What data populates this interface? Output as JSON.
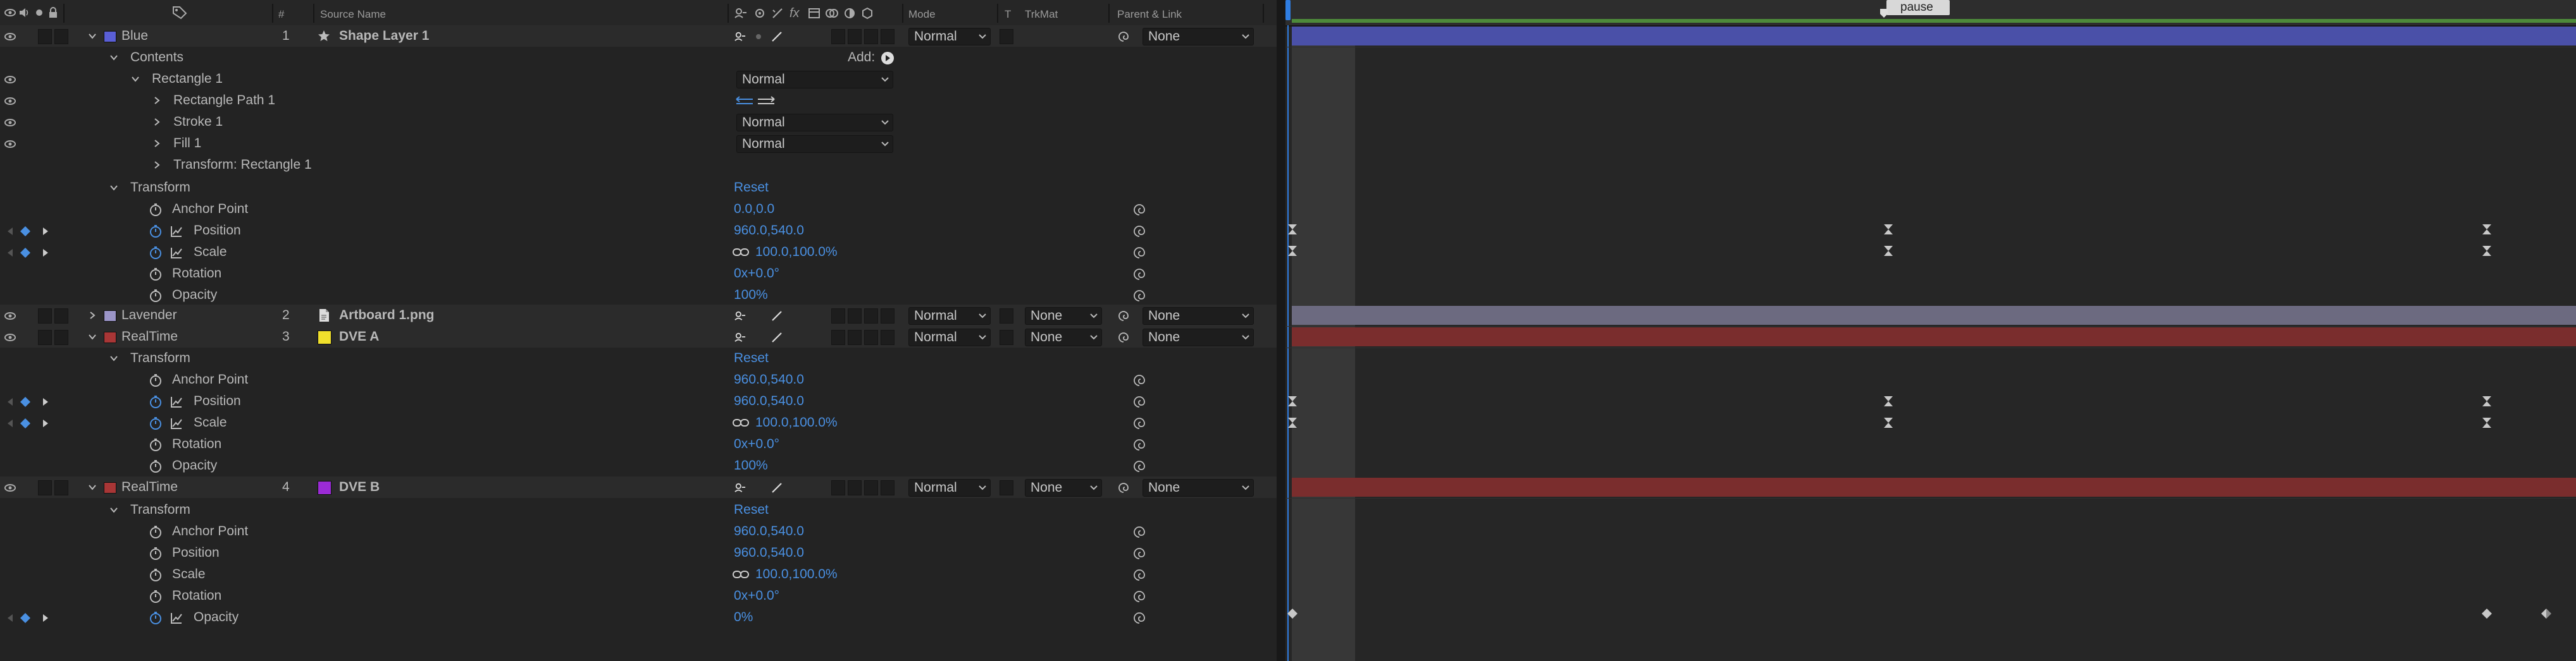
{
  "header": {
    "source_name": "Source Name",
    "number": "#",
    "mode": "Mode",
    "t": "T",
    "trkmat": "TrkMat",
    "parent_link": "Parent & Link"
  },
  "layers": [
    {
      "num": "1",
      "label": "Blue",
      "label_color": "#5a5fd6",
      "name": "Shape Layer 1",
      "source_icon": "star-icon",
      "mode": "Normal",
      "trkmat": "",
      "parent": "None",
      "bar_color": "#4a50a8"
    },
    {
      "num": "2",
      "label": "Lavender",
      "label_color": "#9b95c8",
      "name": "Artboard 1.png",
      "source_icon": "file-icon",
      "mode": "Normal",
      "trkmat": "None",
      "parent": "None",
      "bar_color": "#6c6a80"
    },
    {
      "num": "3",
      "label": "RealTime",
      "label_color": "#a83636",
      "name": "DVE A",
      "source_color": "#f0e02c",
      "mode": "Normal",
      "trkmat": "None",
      "parent": "None",
      "bar_color": "#7a2d2d"
    },
    {
      "num": "4",
      "label": "RealTime",
      "label_color": "#a83636",
      "name": "DVE B",
      "source_color": "#9b2bd6",
      "mode": "Normal",
      "trkmat": "None",
      "parent": "None",
      "bar_color": "#7a2d2d"
    }
  ],
  "contents": {
    "label": "Contents",
    "add": "Add:",
    "rectangle": "Rectangle 1",
    "rectangle_mode": "Normal",
    "path": "Rectangle Path 1",
    "stroke": "Stroke 1",
    "stroke_mode": "Normal",
    "fill": "Fill 1",
    "fill_mode": "Normal",
    "transform_rect": "Transform: Rectangle 1"
  },
  "transform": {
    "label": "Transform",
    "reset": "Reset",
    "anchor_point": "Anchor Point",
    "position": "Position",
    "scale": "Scale",
    "rotation": "Rotation",
    "opacity": "Opacity"
  },
  "values": {
    "l1_anchor": "0.0,0.0",
    "l1_position": "960.0,540.0",
    "l1_scale": "100.0,100.0%",
    "l1_rotation": "0x+0.0°",
    "l1_opacity": "100%",
    "l3_anchor": "960.0,540.0",
    "l3_position": "960.0,540.0",
    "l3_scale": "100.0,100.0%",
    "l3_rotation": "0x+0.0°",
    "l3_opacity": "100%",
    "l4_anchor": "960.0,540.0",
    "l4_position": "960.0,540.0",
    "l4_scale": "100.0,100.0%",
    "l4_rotation": "0x+0.0°",
    "l4_opacity": "0%"
  },
  "timeline": {
    "marker": "pause",
    "colors": {
      "work_area": "#4d8a3a",
      "cti": "#2f7de1",
      "keyframe": "#c8c8c8"
    }
  }
}
